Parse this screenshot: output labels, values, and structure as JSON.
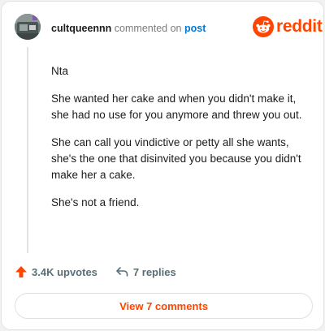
{
  "header": {
    "username": "cultqueennn",
    "commented_text": "commented on",
    "post_link": "post"
  },
  "brand": {
    "wordmark": "reddit",
    "color": "#ff4500",
    "icon": "reddit-alien-icon"
  },
  "comment": {
    "paragraphs": [
      "Nta",
      "She wanted her cake and when you didn't make it, she had no use for you anymore and threw you out.",
      "She can call you vindictive or petty all she wants, she's the one that disinvited you because you didn't make her a cake.",
      "She's not a friend."
    ]
  },
  "actions": {
    "upvotes": "3.4K upvotes",
    "replies": "7 replies",
    "upvote_icon": "upvote-arrow-icon",
    "reply_icon": "reply-arrow-icon"
  },
  "view_comments": {
    "label": "View 7 comments"
  },
  "colors": {
    "accent": "#ff4500",
    "link": "#0079d3",
    "muted": "#7c7c7c"
  }
}
